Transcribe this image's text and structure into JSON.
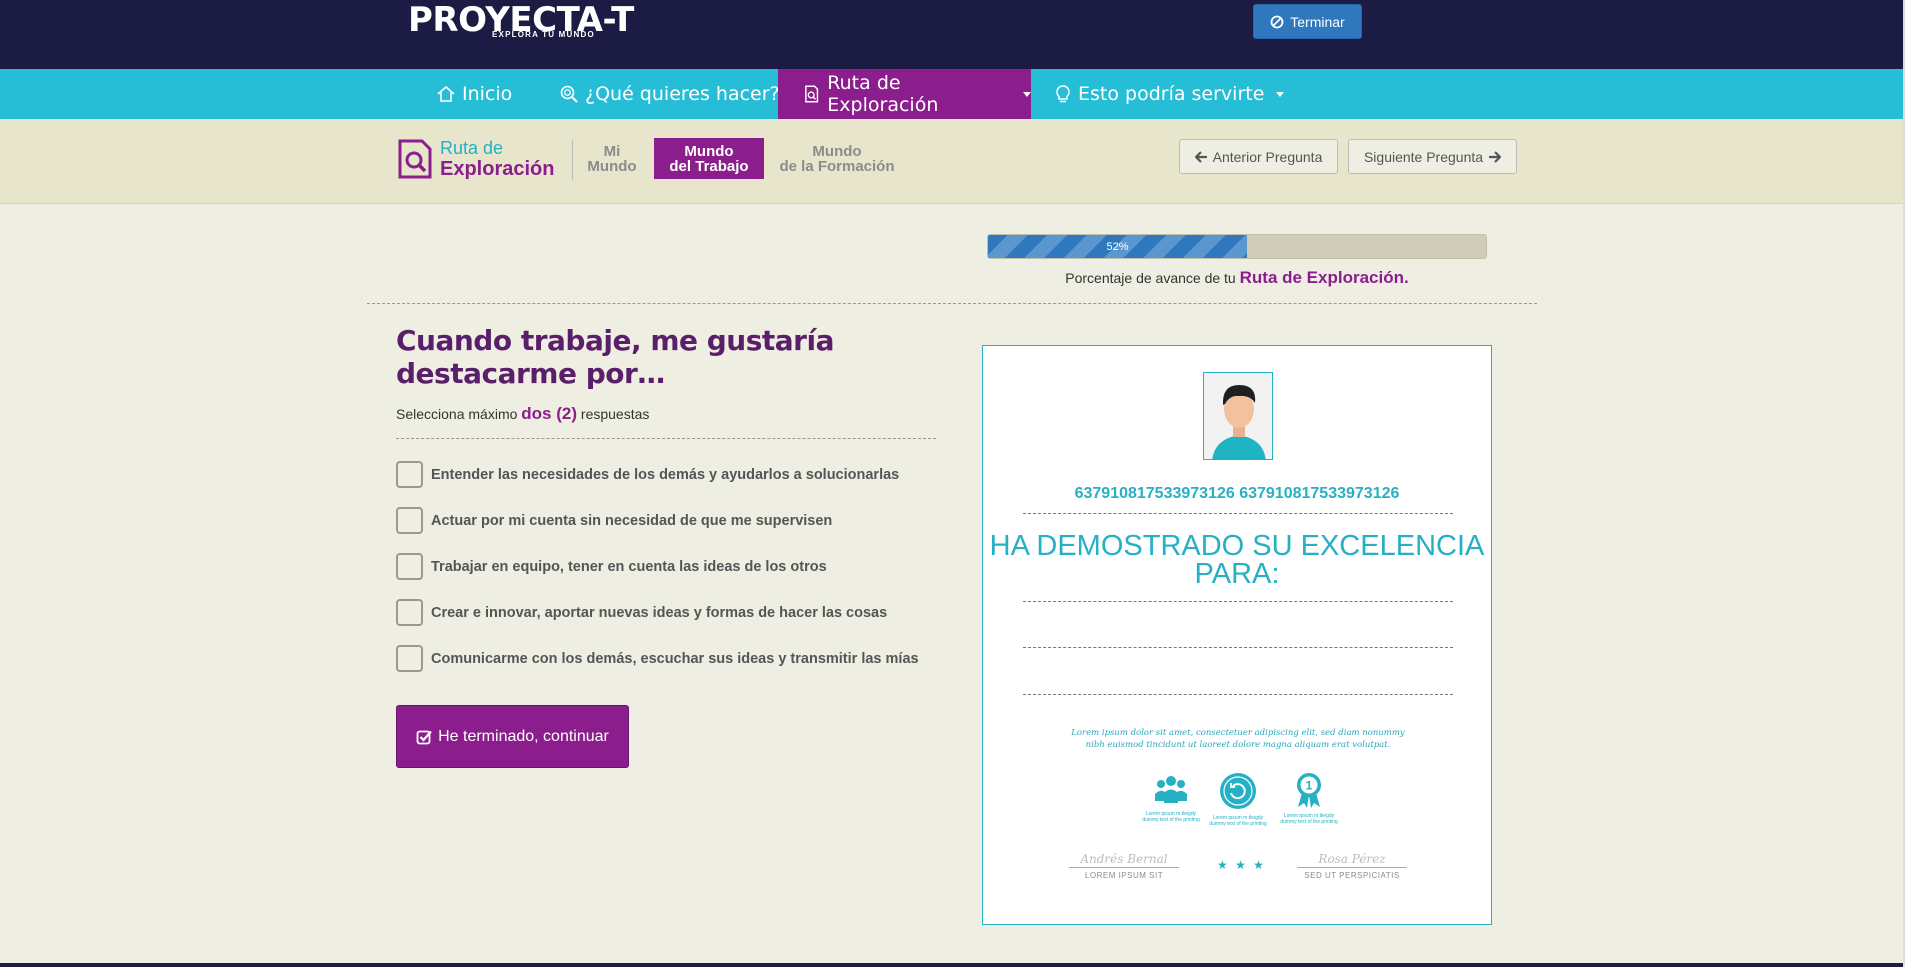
{
  "header": {
    "logo_text": "PROYECTA-T",
    "logo_tagline": "EXPLORA TU MUNDO",
    "terminar_label": "Terminar"
  },
  "nav": {
    "items": [
      {
        "label": "Inicio",
        "icon": "home-icon"
      },
      {
        "label": "¿Qué quieres hacer?",
        "icon": "search-icon"
      },
      {
        "label": "Ruta de Exploración",
        "icon": "document-search-icon",
        "active": true,
        "dropdown": true
      },
      {
        "label": "Esto podría servirte",
        "icon": "lightbulb-icon",
        "dropdown": true
      }
    ]
  },
  "subnav": {
    "brand_line1": "Ruta de",
    "brand_line2": "Exploración",
    "stages": [
      {
        "line1": "Mi",
        "line2": "Mundo"
      },
      {
        "line1": "Mundo",
        "line2": "del Trabajo",
        "active": true
      },
      {
        "line1": "Mundo",
        "line2": "de la Formación"
      }
    ],
    "prev_label": "Anterior Pregunta",
    "next_label": "Siguiente Pregunta"
  },
  "progress": {
    "percent": 52,
    "percent_label": "52%",
    "caption_prefix": "Porcentaje de avance de tu",
    "caption_highlight": "Ruta de Exploración."
  },
  "question": {
    "title": "Cuando trabaje, me gustaría destacarme por…",
    "hint_prefix": "Selecciona máximo",
    "hint_highlight": "dos (2)",
    "hint_suffix": "respuestas",
    "options": [
      "Entender las necesidades de los demás y ayudarlos a solucionarlas",
      "Actuar por mi cuenta sin necesidad de que me supervisen",
      "Trabajar en equipo, tener en cuenta las ideas de los otros",
      "Crear e innovar, aportar nuevas ideas y formas de hacer las cosas",
      "Comunicarme con los demás, escuchar sus ideas y transmitir las mías"
    ],
    "continue_label": "He terminado, continuar"
  },
  "certificate": {
    "id_text": "637910817533973126 637910817533973126",
    "title": "HA DEMOSTRADO SU EXCELENCIA PARA:",
    "lorem": "Lorem ipsum dolor sit amet, consectetuer adipiscing elit, sed diam nonummy nibh euismod tincidunt ut laoreet dolore magna aliquam erat volutpat.",
    "badges": [
      {
        "icon": "team-icon",
        "caption": "Lorem ipsum m tleigdy dummy text of the printing"
      },
      {
        "icon": "arrow-cycle-icon",
        "caption": "Lorem ipsum m tleigdy dummy text of the printing"
      },
      {
        "icon": "ribbon-award-icon",
        "caption": "Lorem ipsum m tleigdy dummy text of the printing"
      }
    ],
    "signatures": [
      {
        "name": "Andrés Bernal",
        "role": "LOREM IPSUM SIT"
      },
      {
        "name": "Rosa Pérez",
        "role": "SED UT PERSPICIATIS"
      }
    ],
    "stars": "★ ★ ★"
  },
  "colors": {
    "topbar": "#1b1b43",
    "navbar": "#26bed7",
    "accent_purple": "#8b1e8c",
    "teal": "#26b0c4",
    "progress_blue": "#2f78bd"
  }
}
